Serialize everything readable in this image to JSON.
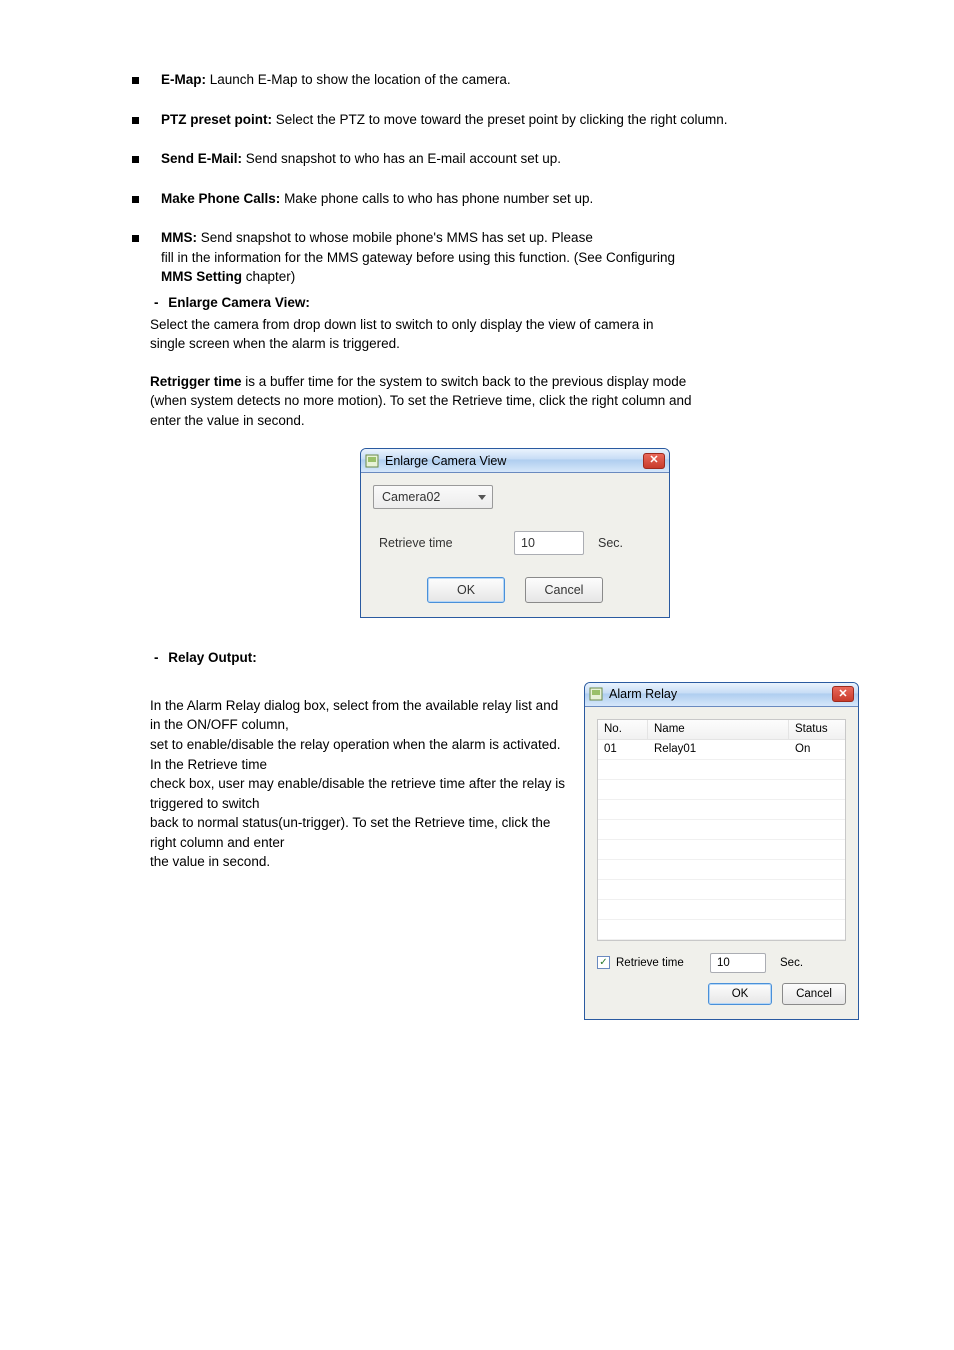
{
  "bullets": {
    "b1": "Launch E-Map to show the location of the camera.",
    "b2": "Select the PTZ to move toward the preset point by clicking the right column.",
    "b3": "Send snapshot to who has an E-mail account set up.",
    "b4": "Make phone calls to who has phone number set up.",
    "b5a": "Send snapshot to whose mobile phone's MMS has set up. Please",
    "b5b": "fill in the information for the MMS gateway before using this function. (See Configuring"
  },
  "subitems": {
    "s1_title": "Enlarge Camera View:",
    "s1_body_a": "Select the camera from drop down list to switch to only display the view of camera in",
    "s1_body_b": "single screen when the alarm is triggered.",
    "s1_body2a": "Retrigger time",
    "s1_body2b": " is a buffer time for the system to switch back to the previous display mode",
    "s1_body2c": "(when system detects no more motion). To set the Retrieve time, click the right column and",
    "s1_body2d": "enter the value in second.",
    "s2_title": "Relay Output:",
    "s2_body_a": "In the Alarm Relay dialog box, select from the available relay list and in the ON/OFF column,",
    "s2_body_b": "set to enable/disable the relay operation when the alarm is activated. In the Retrieve time",
    "s2_body_c": "check box, user may enable/disable the retrieve time after the relay is triggered to switch",
    "s2_body_d": "back to normal status(un-trigger). To set the Retrieve time, click the right column and enter",
    "s2_body_e": "the value in second."
  },
  "dash": "-",
  "bold_labels": {
    "emap": "E-Map:",
    "ptz": "PTZ preset point:",
    "email": "Send E-Mail:",
    "phone": "Make Phone Calls:",
    "mms": "MMS:",
    "mms_chapter": "MMS Setting"
  },
  "dlg1": {
    "title": "Enlarge Camera View",
    "camera": "Camera02",
    "rt_label": "Retrieve time",
    "rt_value": "10",
    "sec": "Sec.",
    "ok": "OK",
    "cancel": "Cancel"
  },
  "dlg2": {
    "title": "Alarm Relay",
    "col_no": "No.",
    "col_name": "Name",
    "col_status": "Status",
    "row1_no": "01",
    "row1_name": "Relay01",
    "row1_status": "On",
    "rt_label": "Retrieve time",
    "rt_value": "10",
    "sec": "Sec.",
    "ok": "OK",
    "cancel": "Cancel"
  }
}
